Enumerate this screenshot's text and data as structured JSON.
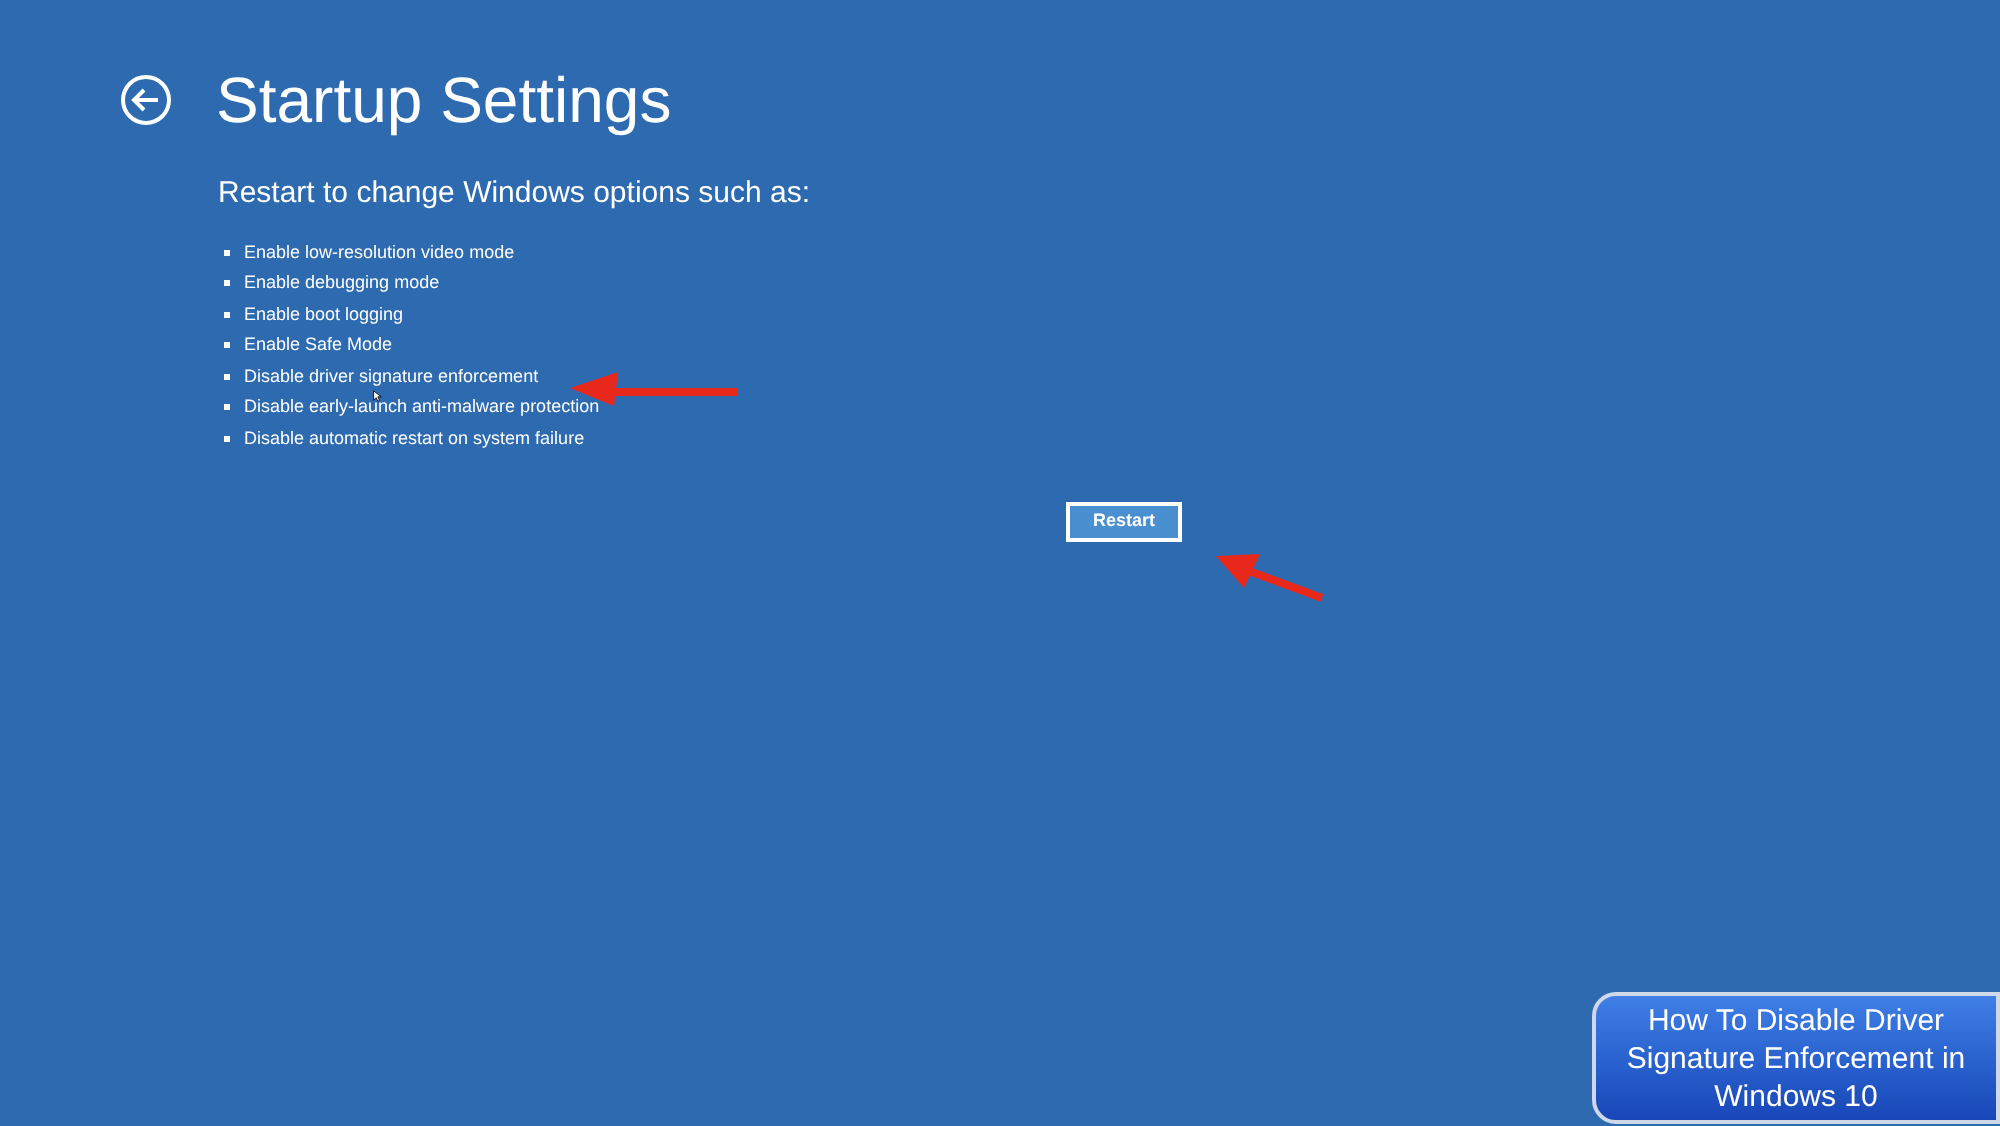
{
  "header": {
    "title": "Startup Settings"
  },
  "intro": "Restart to change Windows options such as:",
  "options": [
    "Enable low-resolution video mode",
    "Enable debugging mode",
    "Enable boot logging",
    "Enable Safe Mode",
    "Disable driver signature enforcement",
    "Disable early-launch anti-malware protection",
    "Disable automatic restart on system failure"
  ],
  "restart_button": {
    "label": "Restart"
  },
  "caption": "How To Disable Driver Signature Enforcement in Windows 10"
}
